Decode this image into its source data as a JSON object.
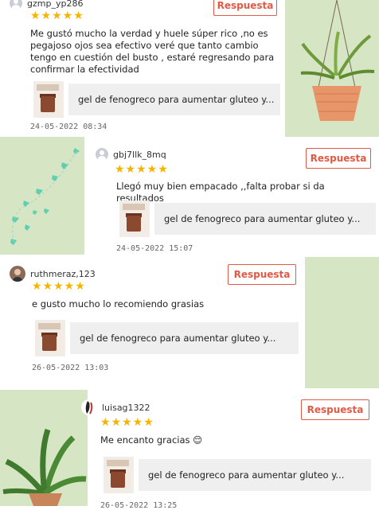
{
  "reply_label": "Respuesta",
  "stars": "★★★★★",
  "reviews": [
    {
      "username": "gzmp_yp286",
      "text": "Me gustó mucho la verdad y huele súper rico ,no es pegajoso ojos sea efectivo veré que tanto cambio tengo en cuestión del busto , estaré regresando para confirmar la efectividad",
      "product": "gel de fenogreco para aumentar gluteo y...",
      "date": "24-05-2022 08:34"
    },
    {
      "username": "gbj7llk_8mq",
      "text": "Llegó muy bien empacado ,,falta probar si da resultados",
      "product": "gel de fenogreco para aumentar gluteo y...",
      "date": "24-05-2022 15:07"
    },
    {
      "username": "ruthmeraz,123",
      "text": "e gusto mucho lo recomiendo grasias",
      "product": "gel de fenogreco para aumentar gluteo y...",
      "date": "26-05-2022 13:03"
    },
    {
      "username": "luisag1322",
      "text": "Me encanto gracias 😌",
      "product": "gel de fenogreco para aumentar gluteo y...",
      "date": "26-05-2022 13:25"
    }
  ],
  "colors": {
    "accent": "#e05a45",
    "star": "#f6b400",
    "band": "#d6e5c3"
  }
}
